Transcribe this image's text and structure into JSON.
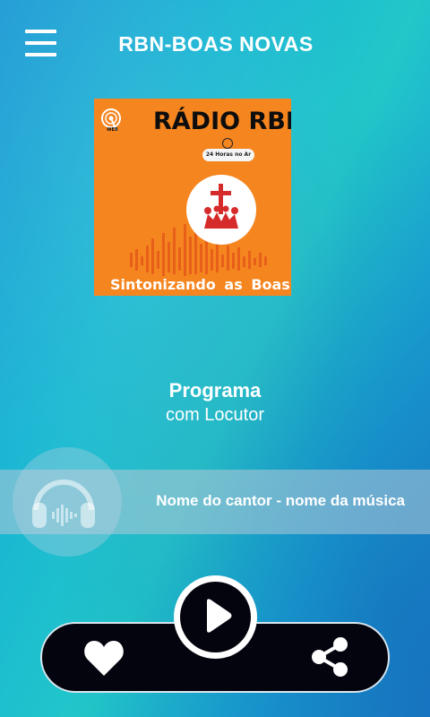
{
  "header": {
    "title": "RBN-BOAS NOVAS",
    "menu_icon": "hamburger-menu-icon"
  },
  "cover": {
    "title": "RÁDIO RBN",
    "badge": "24 Horas no Ar",
    "web_label": "WEB",
    "slogan": "Sintonizando as Boas",
    "colors": {
      "background": "#f5851f",
      "emblem": "#d62b2b"
    }
  },
  "program": {
    "name": "Programa",
    "host": "com Locutor"
  },
  "now_playing": {
    "track": "Nome do cantor - nome da música",
    "icon": "headphones-icon"
  },
  "controls": {
    "like_icon": "heart-icon",
    "play_icon": "play-icon",
    "share_icon": "share-icon"
  }
}
